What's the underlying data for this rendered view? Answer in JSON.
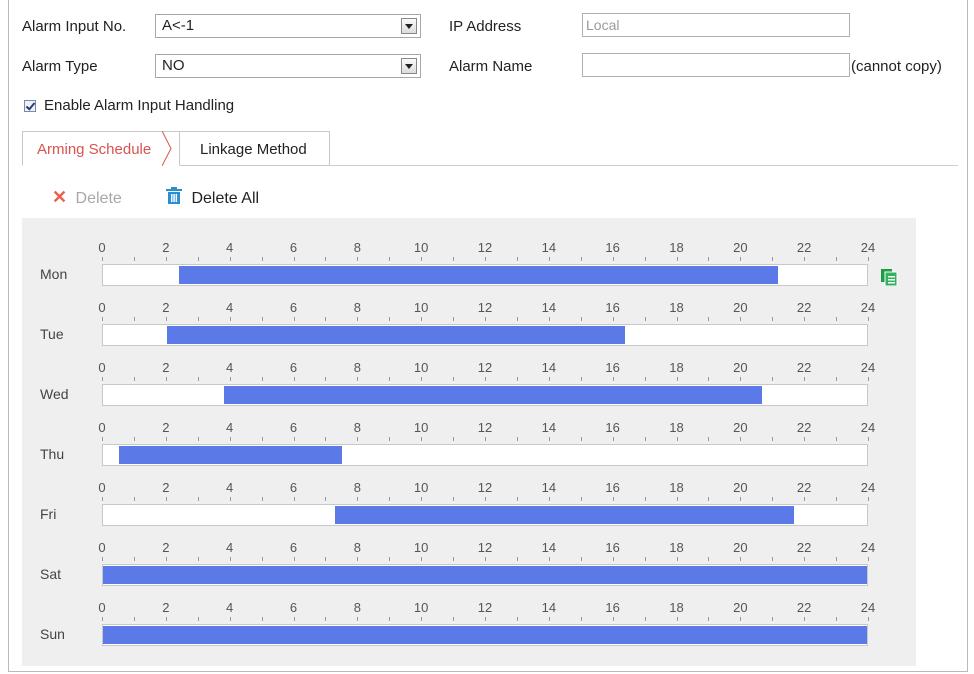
{
  "form": {
    "alarm_input_no_label": "Alarm Input No.",
    "alarm_input_no_value": "A<-1",
    "ip_address_label": "IP Address",
    "ip_address_placeholder": "Local",
    "alarm_type_label": "Alarm Type",
    "alarm_type_value": "NO",
    "alarm_name_label": "Alarm Name",
    "alarm_name_value": "",
    "cannot_copy_note": "(cannot copy)",
    "enable_handling_label": "Enable Alarm Input Handling",
    "enable_handling_checked": true
  },
  "tabs": {
    "arming_schedule": "Arming Schedule",
    "linkage_method": "Linkage Method",
    "active": "arming_schedule"
  },
  "toolbar": {
    "delete_label": "Delete",
    "delete_all_label": "Delete All"
  },
  "schedule": {
    "ticks": [
      "0",
      "2",
      "4",
      "6",
      "8",
      "10",
      "12",
      "14",
      "16",
      "18",
      "20",
      "22",
      "24"
    ],
    "fill_color": "#5b7ae8",
    "days": [
      {
        "name": "Mon",
        "start": 2.4,
        "end": 21.2
      },
      {
        "name": "Tue",
        "start": 2.0,
        "end": 16.4
      },
      {
        "name": "Wed",
        "start": 3.8,
        "end": 20.7
      },
      {
        "name": "Thu",
        "start": 0.5,
        "end": 7.5
      },
      {
        "name": "Fri",
        "start": 7.3,
        "end": 21.7
      },
      {
        "name": "Sat",
        "start": 0,
        "end": 24
      },
      {
        "name": "Sun",
        "start": 0,
        "end": 24
      }
    ]
  }
}
